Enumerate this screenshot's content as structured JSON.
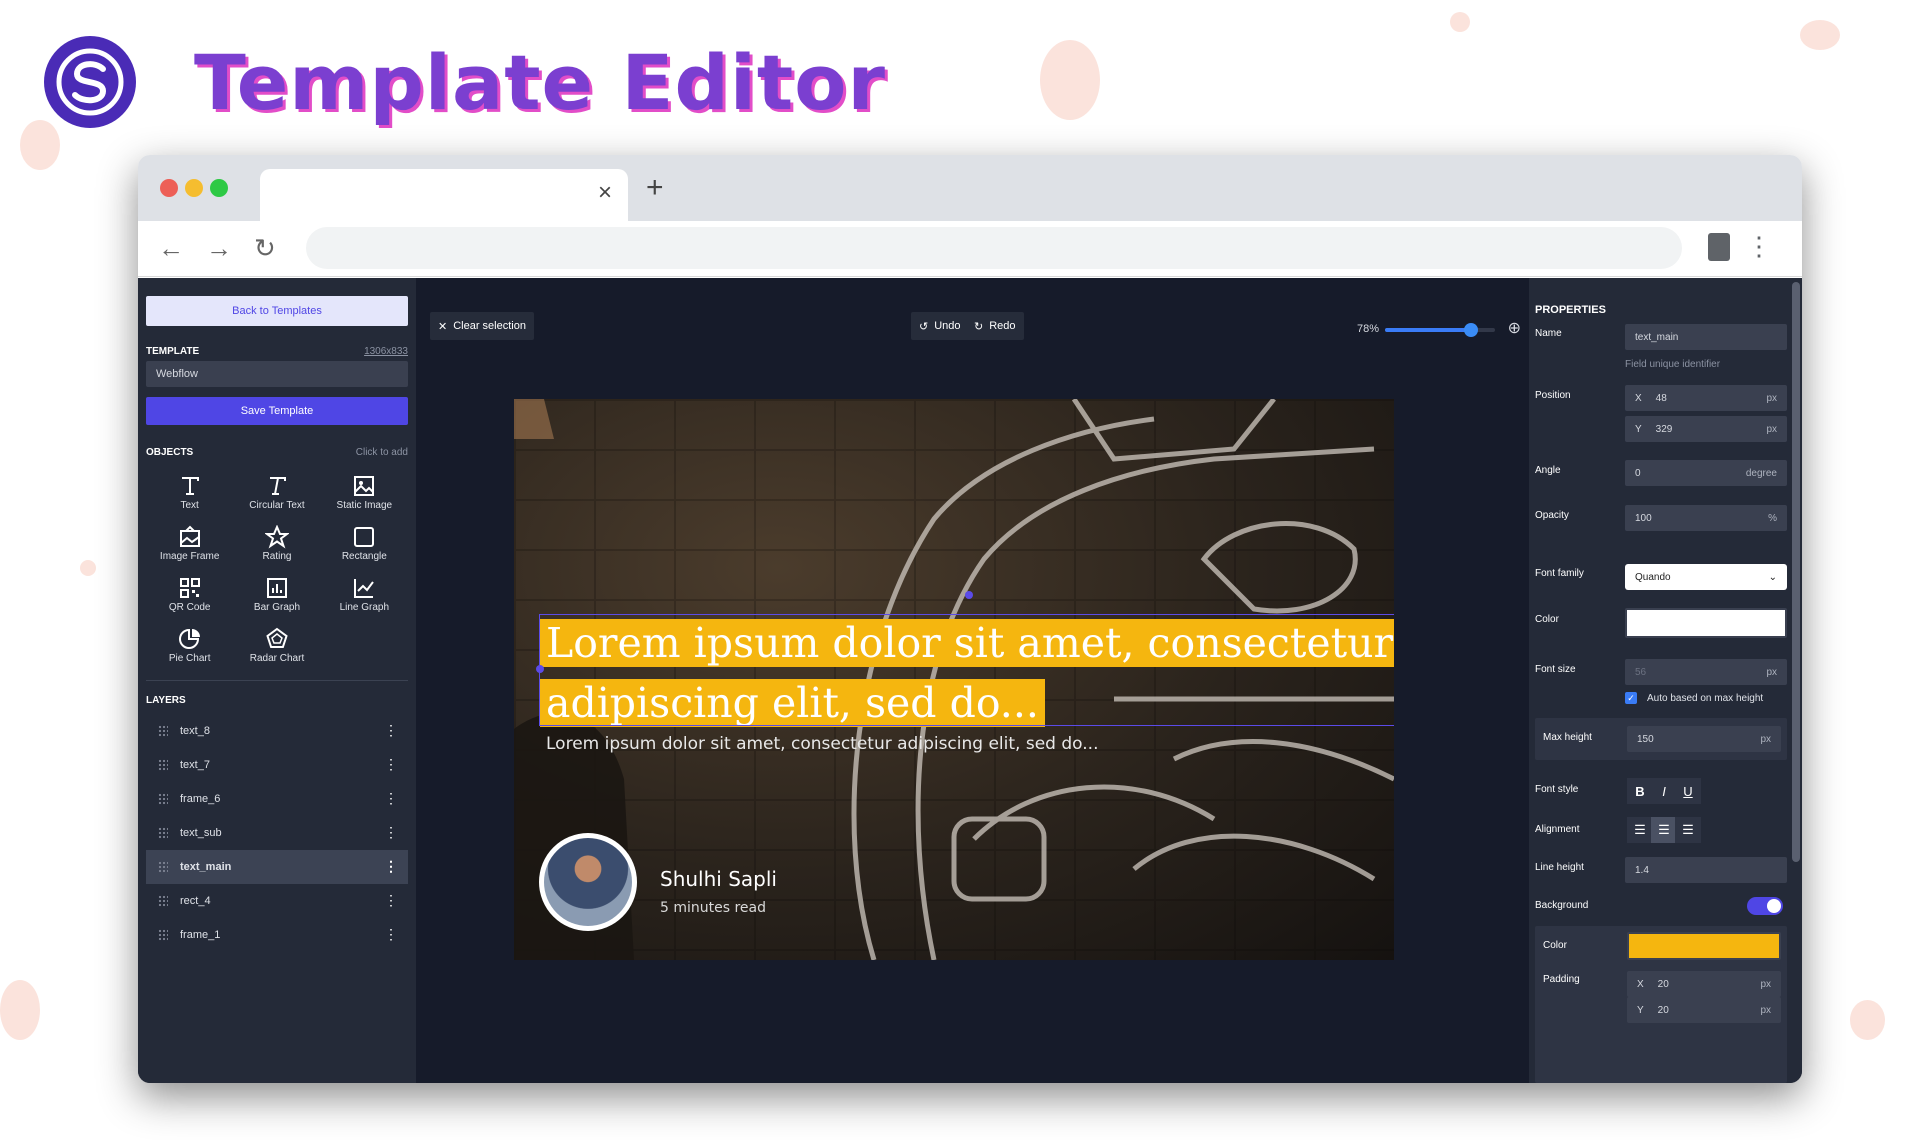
{
  "hero": {
    "title": "Template Editor",
    "logo_icon": "s-logo-icon"
  },
  "browser": {
    "tab_close": "×",
    "new_tab": "+"
  },
  "left": {
    "back_label": "Back to Templates",
    "template_heading": "TEMPLATE",
    "template_size": "1306x833",
    "template_name": "Webflow",
    "save_label": "Save Template",
    "objects_heading": "OBJECTS",
    "objects_hint": "Click to add",
    "objects": [
      {
        "label": "Text",
        "icon": "text-icon"
      },
      {
        "label": "Circular Text",
        "icon": "circular-text-icon"
      },
      {
        "label": "Static Image",
        "icon": "image-icon"
      },
      {
        "label": "Image Frame",
        "icon": "image-frame-icon"
      },
      {
        "label": "Rating",
        "icon": "star-icon"
      },
      {
        "label": "Rectangle",
        "icon": "rectangle-icon"
      },
      {
        "label": "QR Code",
        "icon": "qr-code-icon"
      },
      {
        "label": "Bar Graph",
        "icon": "bar-graph-icon"
      },
      {
        "label": "Line Graph",
        "icon": "line-graph-icon"
      },
      {
        "label": "Pie Chart",
        "icon": "pie-chart-icon"
      },
      {
        "label": "Radar Chart",
        "icon": "radar-chart-icon"
      }
    ],
    "layers_heading": "LAYERS",
    "layers": [
      "text_8",
      "text_7",
      "frame_6",
      "text_sub",
      "text_main",
      "rect_4",
      "frame_1"
    ],
    "active_layer": "text_main"
  },
  "toolbar": {
    "clear": "Clear selection",
    "undo": "Undo",
    "redo": "Redo",
    "zoom": "78%",
    "zoom_fraction": 0.78
  },
  "canvas": {
    "main_text": "Lorem ipsum dolor sit amet, consectetur adipiscing elit, sed do...",
    "sub_text": "Lorem ipsum dolor sit amet, consectetur adipiscing elit, sed do...",
    "author": "Shulhi Sapli",
    "read_time": "5 minutes read",
    "highlight_color": "#f5b60f"
  },
  "props": {
    "title": "PROPERTIES",
    "name_label": "Name",
    "name_value": "text_main",
    "name_hint": "Field unique identifier",
    "position_label": "Position",
    "x_label": "X",
    "x_value": "48",
    "y_label": "Y",
    "y_value": "329",
    "px": "px",
    "angle_label": "Angle",
    "angle_value": "0",
    "angle_unit": "degree",
    "opacity_label": "Opacity",
    "opacity_value": "100",
    "opacity_unit": "%",
    "font_family_label": "Font family",
    "font_family_value": "Quando",
    "color_label": "Color",
    "color_value": "#ffffff",
    "font_size_label": "Font size",
    "font_size_value": "56",
    "auto_label": "Auto based on max height",
    "max_height_label": "Max height",
    "max_height_value": "150",
    "font_style_label": "Font style",
    "bold": "B",
    "italic": "I",
    "underline": "U",
    "alignment_label": "Alignment",
    "line_height_label": "Line height",
    "line_height_value": "1.4",
    "background_label": "Background",
    "bg_color_label": "Color",
    "bg_color_value": "#f5b60f",
    "padding_label": "Padding",
    "pad_x": "20",
    "pad_y": "20"
  }
}
